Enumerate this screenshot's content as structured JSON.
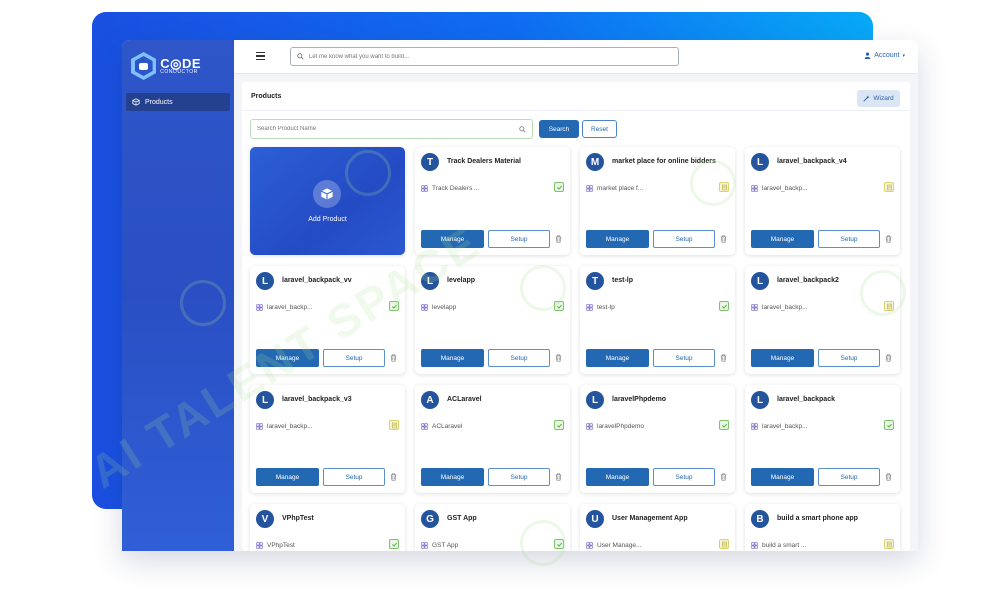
{
  "brand": {
    "line1": "C",
    "line1b": "DE",
    "line2": "CONDUCTOR"
  },
  "sidebar": {
    "items": [
      {
        "label": "Products",
        "icon": "cube-icon"
      }
    ]
  },
  "topbar": {
    "search_placeholder": "Let me know what you want to build...",
    "account_label": "Account"
  },
  "page": {
    "title": "Products",
    "wizard_label": "Wizard"
  },
  "product_search": {
    "placeholder": "Search Product Name",
    "search_label": "Search",
    "reset_label": "Reset"
  },
  "add_card": {
    "label": "Add Product"
  },
  "buttons": {
    "manage": "Manage",
    "setup": "Setup"
  },
  "products": [
    {
      "initial": "T",
      "title": "Track Dealers Material",
      "app": "Track Dealers ...",
      "status": "ok"
    },
    {
      "initial": "M",
      "title": "market place for online bidders",
      "app": "market place f...",
      "status": "doc"
    },
    {
      "initial": "L",
      "title": "laravel_backpack_v4",
      "app": "laravel_backp...",
      "status": "doc"
    },
    {
      "initial": "L",
      "title": "laravel_backpack_vv",
      "app": "laravel_backp...",
      "status": "ok"
    },
    {
      "initial": "L",
      "title": "levelapp",
      "app": "levelapp",
      "status": "ok"
    },
    {
      "initial": "T",
      "title": "test-lp",
      "app": "test-lp",
      "status": "ok"
    },
    {
      "initial": "L",
      "title": "laravel_backpack2",
      "app": "laravel_backp...",
      "status": "doc"
    },
    {
      "initial": "L",
      "title": "laravel_backpack_v3",
      "app": "laravel_backp...",
      "status": "doc"
    },
    {
      "initial": "A",
      "title": "ACLaravel",
      "app": "ACLaravel",
      "status": "ok"
    },
    {
      "initial": "L",
      "title": "laravelPhpdemo",
      "app": "laravelPhpdemo",
      "status": "ok"
    },
    {
      "initial": "L",
      "title": "laravel_backpack",
      "app": "laravel_backp...",
      "status": "ok"
    },
    {
      "initial": "V",
      "title": "VPhpTest",
      "app": "VPhpTest",
      "status": "ok"
    },
    {
      "initial": "G",
      "title": "GST App",
      "app": "GST App",
      "status": "ok"
    },
    {
      "initial": "U",
      "title": "User Management App",
      "app": "User Manage...",
      "status": "doc"
    },
    {
      "initial": "B",
      "title": "build a smart phone app",
      "app": "build a smart ...",
      "status": "doc"
    }
  ],
  "watermark": {
    "text": "AI TALENT SPACE"
  },
  "colors": {
    "primary": "#2368b2",
    "sidebar": "#2e56c9",
    "avatar": "#24549d",
    "ok": "#7cc46a",
    "doc": "#d9d36a"
  }
}
